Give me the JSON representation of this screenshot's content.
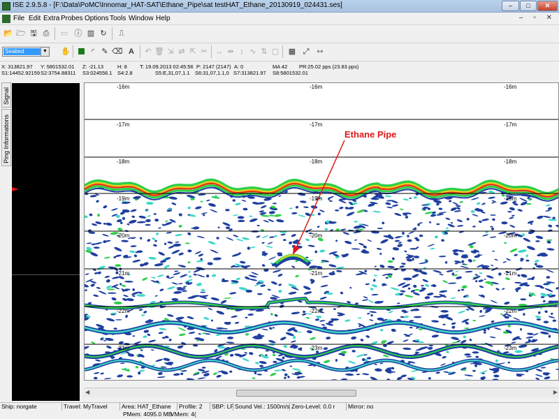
{
  "window": {
    "title": "ISE 2.9.5.8 - [F:\\Data\\PoMC\\Innomar_HAT-SAT\\Ethane_Pipe\\sat testHAT_Ethane_20130919_024431.ses]",
    "minimize": "–",
    "maximize": "□",
    "close": "✕"
  },
  "menu": {
    "items": [
      "File",
      "Edit",
      "Extra",
      "Probes",
      "Options",
      "Tools",
      "Window",
      "Help"
    ],
    "mdi_buttons": "– ▫ ✕"
  },
  "toolbar1": {
    "icons": [
      "open-folder-icon",
      "open-file-icon",
      "save-icon",
      "print-icon",
      "disabled-icon",
      "info-icon",
      "color-palette-icon",
      "refresh-icon",
      "signal-icon"
    ]
  },
  "toolbar2": {
    "layer_select": "Seabed"
  },
  "info": {
    "row1": [
      "X:  313821.97",
      "Y:  5801532.01",
      "Z:  -21.13",
      "H:  8",
      "T: 19.09.2013 02:45:56",
      "P:  2147 (2147)",
      "A:  0",
      "MA 42",
      "PR:25.02 pps (23.83 pps)"
    ],
    "row2": [
      "S1:14452.92159",
      "S2:3754.88311",
      "S3:024556.1",
      "S4:2.8",
      "S5:E,31,07,1.1",
      "S6:31,07,1.1,0",
      "S7:313821.97",
      "S8:5801532.01"
    ]
  },
  "side_tabs": [
    "Signal",
    "Ping Informations"
  ],
  "plot": {
    "depth_labels": [
      "-16m",
      "-17m",
      "-18m",
      "-19m",
      "-20m",
      "-21m",
      "-22m",
      "-23m"
    ],
    "annotation": "Ethane Pipe",
    "colors": {
      "annotation": "#e01818",
      "seabed_red": "#e23a12",
      "seabed_yellow": "#f0d020",
      "green": "#2ecf4a",
      "cyan": "#3fd8c8",
      "blue": "#1f3fa0"
    }
  },
  "status": {
    "ship": "Ship: norgate",
    "travel": "Travel: MyTravel",
    "area": "Area: HAT_Ethane",
    "profile": "Profile: 2",
    "sbp": "SBP: LF",
    "sound_vel": "Sound Vel.: 1500m/s",
    "zero_level": "Zero-Level: 0.0 r",
    "mirror": "Mirror: no",
    "pmem": "PMem: 4095.0 MB",
    "vmem": "VMem: 4("
  }
}
